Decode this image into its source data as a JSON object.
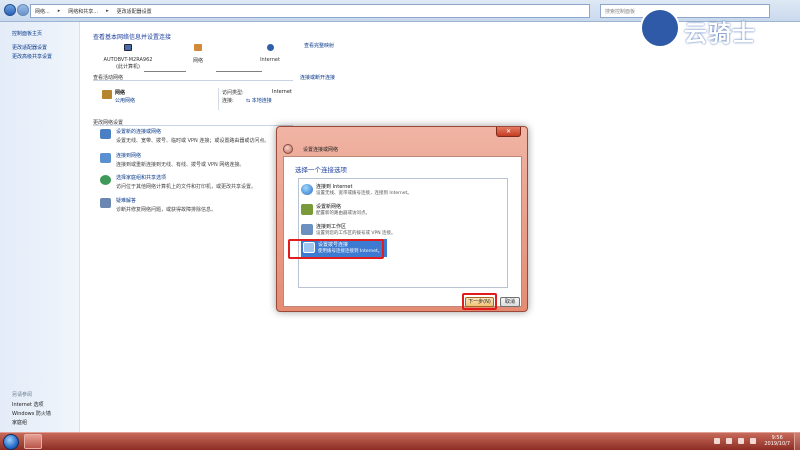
{
  "address": {
    "crumbs": [
      "网络...",
      "网络和共享...",
      "更改适配器设置"
    ],
    "search_placeholder": "搜索控制面板"
  },
  "leftnav": {
    "items": [
      "控制面板主页",
      "更改适配器设置",
      "更改高级共享设置"
    ],
    "see_also_label": "另请参阅",
    "see_also": [
      "Internet 选项",
      "Windows 防火墙",
      "家庭组"
    ]
  },
  "main": {
    "title": "查看基本网络信息并设置连接",
    "full_map": "查看完整映射",
    "map": {
      "computer": "AUTOBVT-M2RA962",
      "computer_sub": "(此计算机)",
      "network": "网络",
      "internet": "Internet"
    },
    "active_label": "查看活动网络",
    "connect_disconnect": "连接或断开连接",
    "network_name": "网络",
    "network_type": "公用网络",
    "access_type_label": "访问类型:",
    "access_type_value": "Internet",
    "connections_label": "连接:",
    "connections_value": "本地连接",
    "change_label": "更改网络设置",
    "tasks": [
      {
        "title": "设置新的连接或网络",
        "desc": "设置无线、宽带、拨号、临时或 VPN 连接；或设置路由器或访问点。"
      },
      {
        "title": "连接到网络",
        "desc": "连接到或重新连接到无线、有线、拨号或 VPN 网络连接。"
      },
      {
        "title": "选择家庭组和共享选项",
        "desc": "访问位于其他网络计算机上的文件和打印机，或更改共享设置。"
      },
      {
        "title": "疑难解答",
        "desc": "诊断并修复网络问题，或获得故障排除信息。"
      }
    ]
  },
  "dialog": {
    "title": "设置连接或网络",
    "heading": "选择一个连接选项",
    "options": [
      {
        "title": "连接到 Internet",
        "desc": "设置无线、宽带或拨号连接，连接到 Internet。"
      },
      {
        "title": "设置新网络",
        "desc": "配置新的路由器或访问点。"
      },
      {
        "title": "连接到工作区",
        "desc": "设置到您的工作区的拨号或 VPN 连接。"
      },
      {
        "title": "设置拨号连接",
        "desc": "使用拨号连接连接到 Internet。"
      }
    ],
    "selected_index": 3,
    "next_label": "下一步(N)",
    "cancel_label": "取消",
    "close_glyph": "✕"
  },
  "logo": {
    "text": "云骑士"
  },
  "taskbar": {
    "time": "9:56",
    "date": "2019/10/7"
  }
}
